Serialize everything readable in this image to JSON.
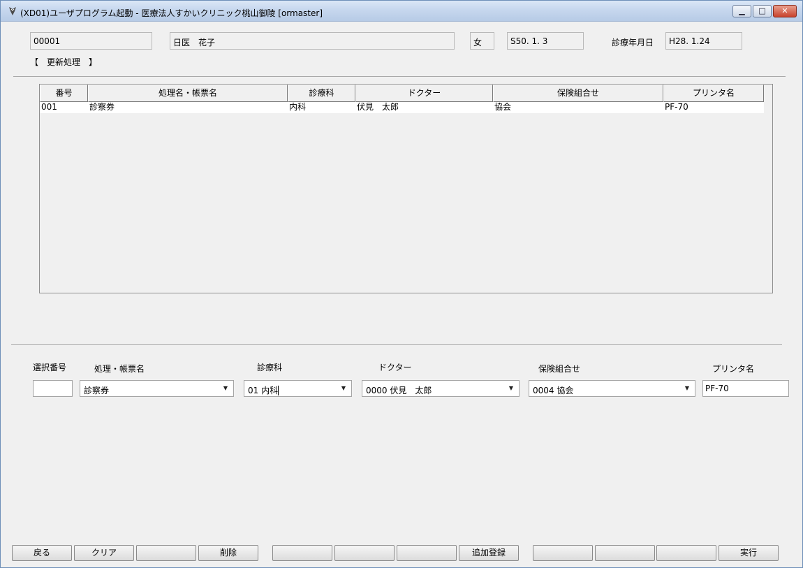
{
  "window": {
    "title": "(XD01)ユーザプログラム起動 - 医療法人すかいクリニック桃山御陵 [ormaster]",
    "buttons": {
      "minimize": "▁",
      "maximize": "□",
      "close": "✕"
    }
  },
  "patient": {
    "id": "00001",
    "name": "日医　花子",
    "sex": "女",
    "birthdate": "S50. 1. 3",
    "visit_date_label": "診療年月日",
    "visit_date": "H28. 1.24"
  },
  "mode_label": "【　更新処理　】",
  "table": {
    "columns": [
      "番号",
      "処理名・帳票名",
      "診療科",
      "ドクター",
      "保険組合せ",
      "プリンタ名"
    ],
    "rows": [
      [
        "001",
        "診察券",
        "内科",
        "伏見　太郎",
        "協会",
        "PF-70"
      ]
    ]
  },
  "form": {
    "labels": {
      "select_no": "選択番号",
      "process_name": "処理・帳票名",
      "department": "診療科",
      "doctor": "ドクター",
      "insurance": "保険組合せ",
      "printer": "プリンタ名"
    },
    "values": {
      "select_no": "",
      "process_name": "診察券",
      "department": "01 内科",
      "doctor": "0000 伏見　太郎",
      "insurance": "0004 協会",
      "printer": "PF-70"
    }
  },
  "function_keys": [
    "戻る",
    "クリア",
    "",
    "削除",
    "",
    "",
    "",
    "追加登録",
    "",
    "",
    "",
    "実行"
  ],
  "icons": {
    "app": "ormaster-app-icon",
    "dropdown": "chevron-down-icon"
  }
}
